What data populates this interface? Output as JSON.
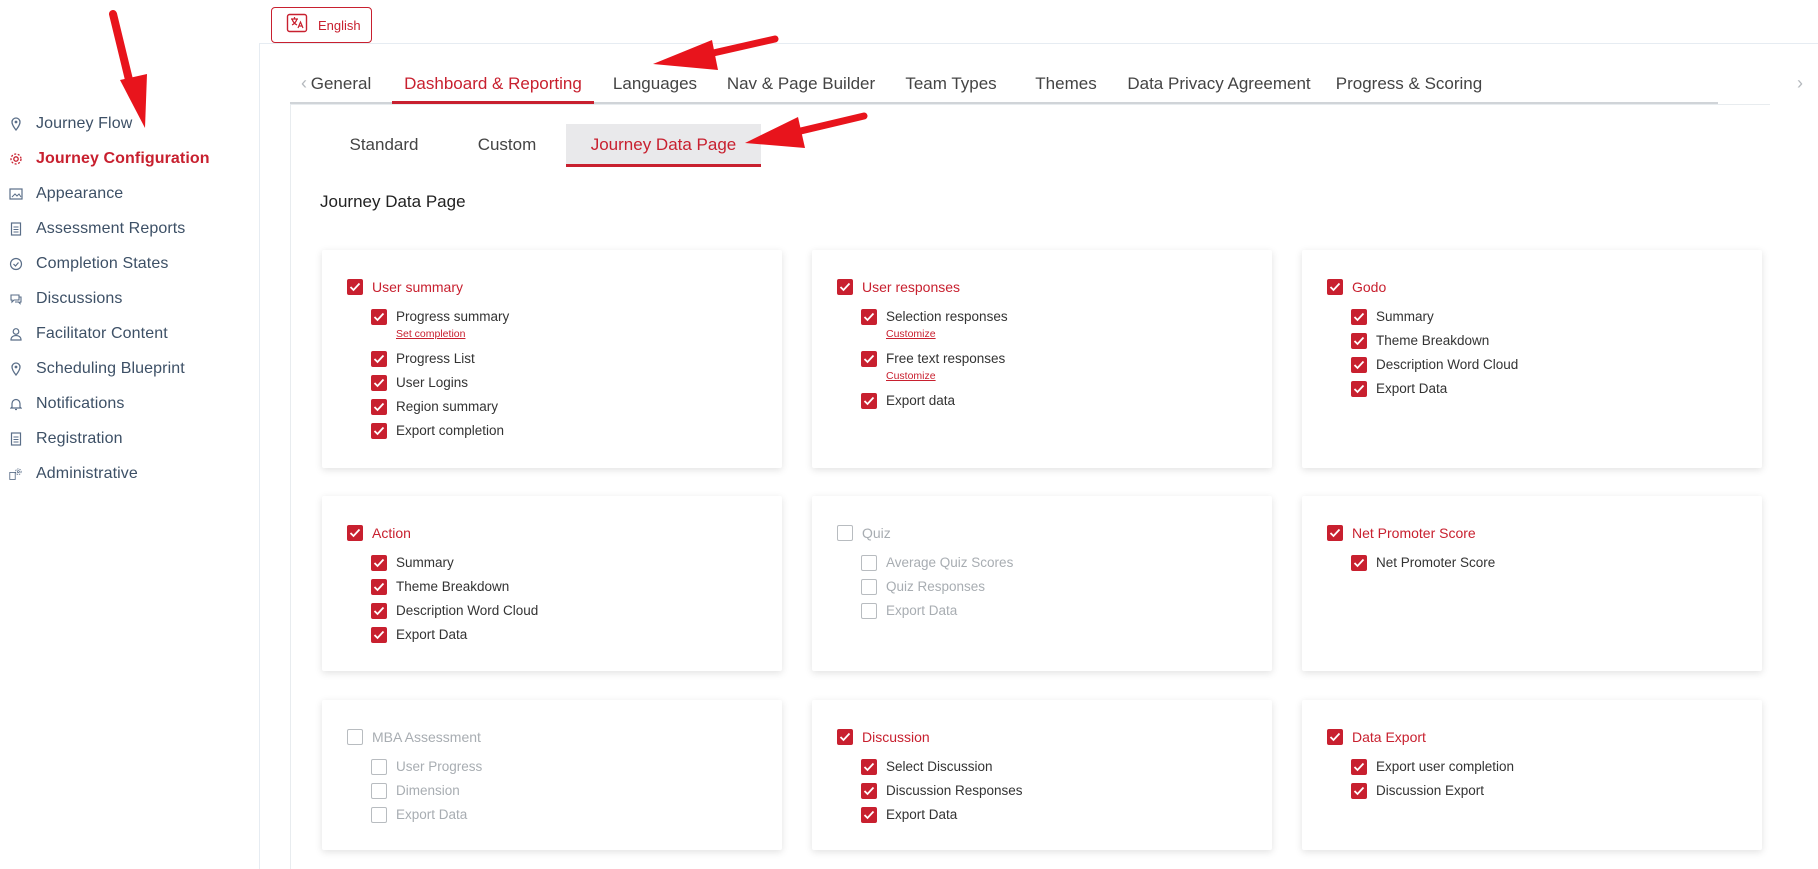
{
  "language_button": {
    "label": "English"
  },
  "sidebar": {
    "items": [
      {
        "label": "Journey Flow",
        "icon": "map-pin-icon",
        "active": false
      },
      {
        "label": "Journey Configuration",
        "icon": "gear-icon",
        "active": true
      },
      {
        "label": "Appearance",
        "icon": "image-icon",
        "active": false
      },
      {
        "label": "Assessment Reports",
        "icon": "document-icon",
        "active": false
      },
      {
        "label": "Completion States",
        "icon": "check-circle-icon",
        "active": false
      },
      {
        "label": "Discussions",
        "icon": "chat-icon",
        "active": false
      },
      {
        "label": "Facilitator Content",
        "icon": "user-icon",
        "active": false
      },
      {
        "label": "Scheduling Blueprint",
        "icon": "map-pin-icon",
        "active": false
      },
      {
        "label": "Notifications",
        "icon": "bell-icon",
        "active": false
      },
      {
        "label": "Registration",
        "icon": "document-icon",
        "active": false
      },
      {
        "label": "Administrative",
        "icon": "admin-gear-icon",
        "active": false
      }
    ]
  },
  "tabs": [
    {
      "label": "General",
      "active": false
    },
    {
      "label": "Dashboard & Reporting",
      "active": true
    },
    {
      "label": "Languages",
      "active": false
    },
    {
      "label": "Nav & Page Builder",
      "active": false
    },
    {
      "label": "Team Types",
      "active": false
    },
    {
      "label": "Themes",
      "active": false
    },
    {
      "label": "Data Privacy Agreement",
      "active": false
    },
    {
      "label": "Progress & Scoring",
      "active": false
    }
  ],
  "subtabs": [
    {
      "label": "Standard",
      "active": false
    },
    {
      "label": "Custom",
      "active": false
    },
    {
      "label": "Journey Data Page",
      "active": true
    }
  ],
  "section_title": "Journey Data Page",
  "cards": [
    {
      "title": "User summary",
      "checked": true,
      "options": [
        {
          "label": "Progress summary",
          "checked": true,
          "link": "Set completion"
        },
        {
          "label": "Progress List",
          "checked": true
        },
        {
          "label": "User Logins",
          "checked": true
        },
        {
          "label": "Region summary",
          "checked": true
        },
        {
          "label": "Export completion",
          "checked": true
        }
      ]
    },
    {
      "title": "User responses",
      "checked": true,
      "options": [
        {
          "label": "Selection responses",
          "checked": true,
          "link": "Customize"
        },
        {
          "label": "Free text responses",
          "checked": true,
          "link": "Customize"
        },
        {
          "label": "Export data",
          "checked": true
        }
      ]
    },
    {
      "title": "Godo",
      "checked": true,
      "options": [
        {
          "label": "Summary",
          "checked": true
        },
        {
          "label": "Theme Breakdown",
          "checked": true
        },
        {
          "label": "Description Word Cloud",
          "checked": true
        },
        {
          "label": "Export Data",
          "checked": true
        }
      ]
    },
    {
      "title": "Action",
      "checked": true,
      "options": [
        {
          "label": "Summary",
          "checked": true
        },
        {
          "label": "Theme Breakdown",
          "checked": true
        },
        {
          "label": "Description Word Cloud",
          "checked": true
        },
        {
          "label": "Export Data",
          "checked": true
        }
      ]
    },
    {
      "title": "Quiz",
      "checked": false,
      "options": [
        {
          "label": "Average Quiz Scores",
          "checked": false
        },
        {
          "label": "Quiz Responses",
          "checked": false
        },
        {
          "label": "Export Data",
          "checked": false
        }
      ]
    },
    {
      "title": "Net Promoter Score",
      "checked": true,
      "options": [
        {
          "label": "Net Promoter Score",
          "checked": true
        }
      ]
    },
    {
      "title": "MBA Assessment",
      "checked": false,
      "options": [
        {
          "label": "User Progress",
          "checked": false
        },
        {
          "label": "Dimension",
          "checked": false
        },
        {
          "label": "Export Data",
          "checked": false
        }
      ]
    },
    {
      "title": "Discussion",
      "checked": true,
      "options": [
        {
          "label": "Select Discussion",
          "checked": true
        },
        {
          "label": "Discussion Responses",
          "checked": true
        },
        {
          "label": "Export Data",
          "checked": true
        }
      ]
    },
    {
      "title": "Data Export",
      "checked": true,
      "options": [
        {
          "label": "Export user completion",
          "checked": true
        },
        {
          "label": "Discussion Export",
          "checked": true
        }
      ]
    }
  ],
  "colors": {
    "accent": "#c8202f",
    "sidebar_text": "#3d5066",
    "disabled": "#a8adb2"
  }
}
